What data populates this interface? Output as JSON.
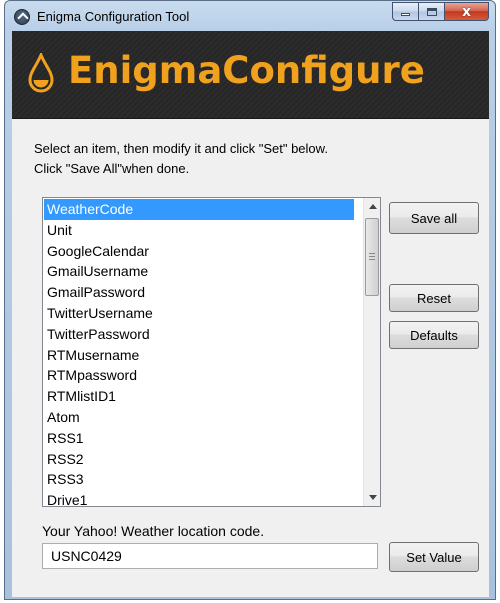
{
  "window": {
    "title": "Enigma Configuration Tool",
    "close_glyph": "x"
  },
  "banner": {
    "title": "EnigmaConfigure",
    "icon": "water-drop-icon",
    "accent_color": "#f0a21e"
  },
  "instructions": {
    "line1": "Select an item, then modify it and click \"Set\" below.",
    "line2": "Click \"Save All\"when done."
  },
  "list": {
    "selected_index": 0,
    "items": [
      "WeatherCode",
      "Unit",
      "GoogleCalendar",
      "GmailUsername",
      "GmailPassword",
      "TwitterUsername",
      "TwitterPassword",
      "RTMusername",
      "RTMpassword",
      "RTMlistID1",
      "Atom",
      "RSS1",
      "RSS2",
      "RSS3",
      "Drive1"
    ]
  },
  "buttons": {
    "save_all": "Save all",
    "reset": "Reset",
    "defaults": "Defaults",
    "set_value": "Set Value"
  },
  "field": {
    "label": "Your Yahoo! Weather location code.",
    "value": "USNC0429"
  }
}
